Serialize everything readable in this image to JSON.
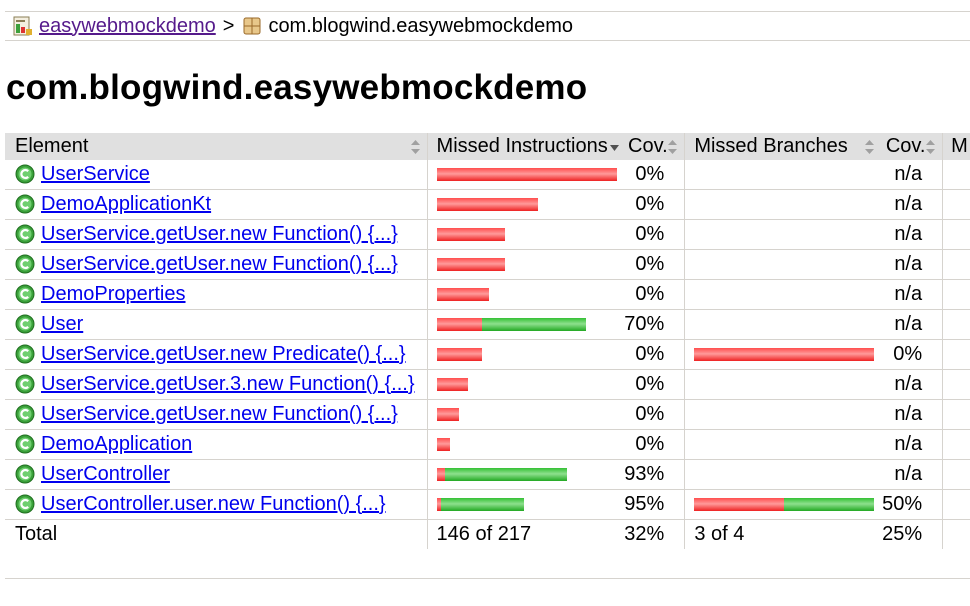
{
  "breadcrumb": {
    "root_label": "easywebmockdemo",
    "separator": ">",
    "current_label": "com.blogwind.easywebmockdemo"
  },
  "page_title": "com.blogwind.easywebmockdemo",
  "table": {
    "headers": {
      "element": "Element",
      "missed_instructions": "Missed Instructions",
      "cov_instructions": "Cov.",
      "missed_branches": "Missed Branches",
      "cov_branches": "Cov.",
      "more": "M"
    },
    "rows": [
      {
        "name": "UserService",
        "instr_missed_frac": 1.0,
        "instr_covered_frac": 0.0,
        "instr_cov": "0%",
        "branch_missed_frac": 0,
        "branch_covered_frac": 0,
        "branch_cov": "n/a"
      },
      {
        "name": "DemoApplicationKt",
        "instr_missed_frac": 0.56,
        "instr_covered_frac": 0.0,
        "instr_cov": "0%",
        "branch_missed_frac": 0,
        "branch_covered_frac": 0,
        "branch_cov": "n/a"
      },
      {
        "name": "UserService.getUser.new Function() {...}",
        "instr_missed_frac": 0.38,
        "instr_covered_frac": 0.0,
        "instr_cov": "0%",
        "branch_missed_frac": 0,
        "branch_covered_frac": 0,
        "branch_cov": "n/a"
      },
      {
        "name": "UserService.getUser.new Function() {...}",
        "instr_missed_frac": 0.38,
        "instr_covered_frac": 0.0,
        "instr_cov": "0%",
        "branch_missed_frac": 0,
        "branch_covered_frac": 0,
        "branch_cov": "n/a"
      },
      {
        "name": "DemoProperties",
        "instr_missed_frac": 0.29,
        "instr_covered_frac": 0.0,
        "instr_cov": "0%",
        "branch_missed_frac": 0,
        "branch_covered_frac": 0,
        "branch_cov": "n/a"
      },
      {
        "name": "User",
        "instr_missed_frac": 0.25,
        "instr_covered_frac": 0.58,
        "instr_cov": "70%",
        "branch_missed_frac": 0,
        "branch_covered_frac": 0,
        "branch_cov": "n/a"
      },
      {
        "name": "UserService.getUser.new Predicate() {...}",
        "instr_missed_frac": 0.25,
        "instr_covered_frac": 0.0,
        "instr_cov": "0%",
        "branch_missed_frac": 1.0,
        "branch_covered_frac": 0.0,
        "branch_cov": "0%"
      },
      {
        "name": "UserService.getUser.3.new Function() {...}",
        "instr_missed_frac": 0.17,
        "instr_covered_frac": 0.0,
        "instr_cov": "0%",
        "branch_missed_frac": 0,
        "branch_covered_frac": 0,
        "branch_cov": "n/a"
      },
      {
        "name": "UserService.getUser.new Function() {...}",
        "instr_missed_frac": 0.12,
        "instr_covered_frac": 0.0,
        "instr_cov": "0%",
        "branch_missed_frac": 0,
        "branch_covered_frac": 0,
        "branch_cov": "n/a"
      },
      {
        "name": "DemoApplication",
        "instr_missed_frac": 0.07,
        "instr_covered_frac": 0.0,
        "instr_cov": "0%",
        "branch_missed_frac": 0,
        "branch_covered_frac": 0,
        "branch_cov": "n/a"
      },
      {
        "name": "UserController",
        "instr_missed_frac": 0.045,
        "instr_covered_frac": 0.675,
        "instr_cov": "93%",
        "branch_missed_frac": 0,
        "branch_covered_frac": 0,
        "branch_cov": "n/a"
      },
      {
        "name": "UserController.user.new Function() {...}",
        "instr_missed_frac": 0.02,
        "instr_covered_frac": 0.46,
        "instr_cov": "95%",
        "branch_missed_frac": 0.5,
        "branch_covered_frac": 0.5,
        "branch_cov": "50%"
      }
    ],
    "total": {
      "label": "Total",
      "missed_instructions": "146 of 217",
      "instr_cov": "32%",
      "missed_branches": "3 of 4",
      "branch_cov": "25%"
    }
  },
  "colors": {
    "missed": "#ff4d4d",
    "covered": "#34c034",
    "header_bg": "#e0e0e0",
    "link": "#0000ee",
    "visited_link": "#551a8b"
  },
  "icons": {
    "breadcrumb_root": "report-icon",
    "breadcrumb_current": "package-icon",
    "class": "class-c-icon",
    "sort": "sort-arrows-icon"
  }
}
